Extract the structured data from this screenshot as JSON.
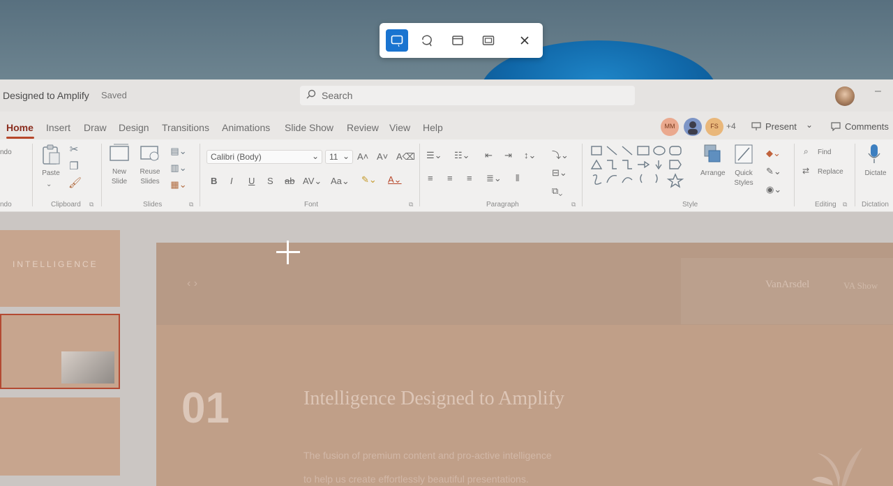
{
  "snipping_toolbar": {
    "modes": [
      {
        "name": "rectangle-mode",
        "active": true
      },
      {
        "name": "freeform-mode",
        "active": false
      },
      {
        "name": "window-mode",
        "active": false
      },
      {
        "name": "fullscreen-mode",
        "active": false
      }
    ],
    "close_icon": "close-icon"
  },
  "titlebar": {
    "doc_title": "Designed to Amplify",
    "saved_status": "Saved",
    "search_placeholder": "Search",
    "minimize_glyph": "–"
  },
  "tabs": [
    "Home",
    "Insert",
    "Draw",
    "Design",
    "Transitions",
    "Animations",
    "Slide Show",
    "Review",
    "View",
    "Help"
  ],
  "active_tab": "Home",
  "collab": {
    "avatars": [
      {
        "initials": "MM",
        "color": "#e9a98f"
      },
      {
        "initials": "",
        "color": "#7d95c6"
      },
      {
        "initials": "FS",
        "color": "#e9b77a"
      }
    ],
    "more_count": "+4",
    "present_label": "Present",
    "comments_label": "Comments"
  },
  "ribbon": {
    "undo_partial": "ndo",
    "undo_group_partial": "ndo",
    "clipboard": {
      "paste": "Paste",
      "label": "Clipboard"
    },
    "slides": {
      "new_slide": "New Slide",
      "reuse_slides": "Reuse Slides",
      "label": "Slides"
    },
    "font": {
      "family": "Calibri (Body)",
      "size": "11",
      "label": "Font"
    },
    "paragraph": {
      "label": "Paragraph"
    },
    "drawing": {
      "arrange": "Arrange",
      "quick_styles": "Quick Styles",
      "label": "Style"
    },
    "editing": {
      "find": "Find",
      "replace": "Replace",
      "label": "Editing"
    },
    "dictation": {
      "dictate": "Dictate",
      "label": "Dictation"
    }
  },
  "thumbnails": [
    {
      "text": "INTELLIGENCE",
      "selected": false
    },
    {
      "text": "",
      "selected": true
    },
    {
      "text": "",
      "selected": false
    }
  ],
  "slide": {
    "number": "01",
    "title": "Intelligence Designed to Amplify",
    "subtitle_line1": "The fusion of premium content and pro-active intelligence",
    "subtitle_line2": "to help us create effortlessly beautiful presentations.",
    "logo_primary": "VanArsdel",
    "logo_secondary": "VA Show",
    "nav_arrows": "‹   ›"
  },
  "colors": {
    "accent": "#b7472a",
    "snip_active": "#1a74d0"
  }
}
